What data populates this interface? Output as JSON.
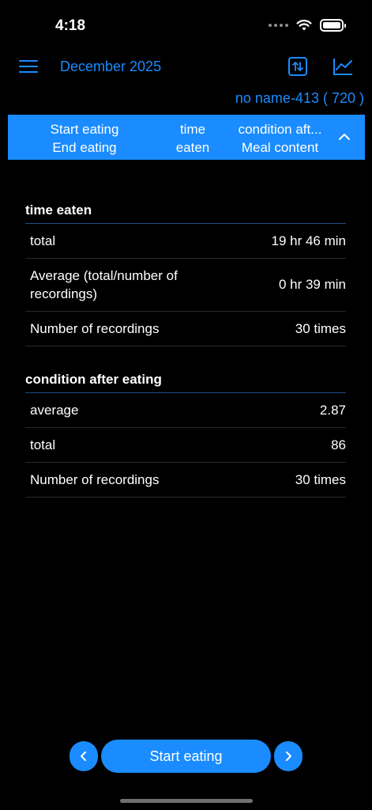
{
  "status_bar": {
    "time": "4:18"
  },
  "header": {
    "month": "December 2025",
    "user": "no name-413  ( 720 )"
  },
  "columns": {
    "col1_line1": "Start eating",
    "col1_line2": "End eating",
    "col2_line1": "time",
    "col2_line2": "eaten",
    "col3_line1": "condition aft...",
    "col3_line2": "Meal content"
  },
  "time_eaten": {
    "title": "time eaten",
    "rows": [
      {
        "label": "total",
        "value": "19 hr 46 min"
      },
      {
        "label": "Average (total/number of recordings)",
        "value": "0 hr 39 min"
      },
      {
        "label": "Number of recordings",
        "value": "30 times"
      }
    ]
  },
  "condition": {
    "title": "condition after eating",
    "rows": [
      {
        "label": "average",
        "value": "2.87"
      },
      {
        "label": "total",
        "value": "86"
      },
      {
        "label": "Number of recordings",
        "value": "30 times"
      }
    ]
  },
  "footer": {
    "start_label": "Start eating"
  },
  "colors": {
    "accent": "#1a8cff",
    "background": "#000000"
  },
  "icons": [
    "hamburger-menu-icon",
    "sort-arrows-icon",
    "line-chart-icon",
    "chevron-up-icon",
    "chevron-left-icon",
    "chevron-right-icon",
    "wifi-icon",
    "battery-icon"
  ]
}
